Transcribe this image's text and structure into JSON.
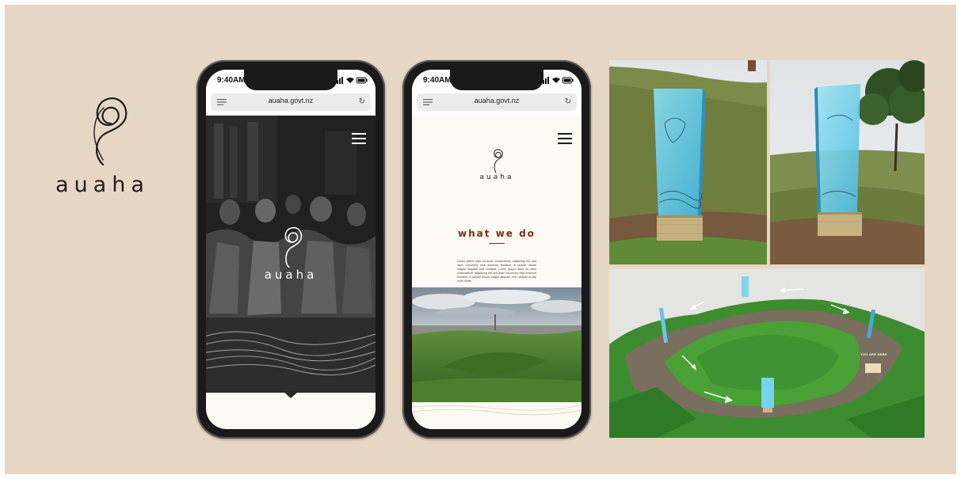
{
  "brand": {
    "wordmark": "auaha",
    "logo_icon": "koru-swirl-icon"
  },
  "phone_left": {
    "status": {
      "time": "9:40AM"
    },
    "browser": {
      "url": "auaha.govt.nz"
    },
    "hero": {
      "wordmark": "auaha"
    }
  },
  "phone_right": {
    "status": {
      "time": "9:40AM"
    },
    "browser": {
      "url": "auaha.govt.nz"
    },
    "wordmark": "auaha",
    "heading": "what we do",
    "body": "Lorem ipsum dolor sit amet, consectetuer adipiscing elit, sed diam nonummy nibh euismod tincidunt ut laoreet dolore magna aliquam erat volutpat. Lorem ipsum dolor sit amet consectetuer adipiscing elit sed diam nonummy nibh euismod tincidunt ut laoreet dolore magna aliquam erat volutpat ut wisi enim minim"
  },
  "site_model": {
    "sign_label": "YOU ARE HERE"
  },
  "colors": {
    "board": "#e6d6c4",
    "accent": "#7a2b16",
    "glass": "#5fc4e6",
    "grass": "#3f7d2c"
  }
}
